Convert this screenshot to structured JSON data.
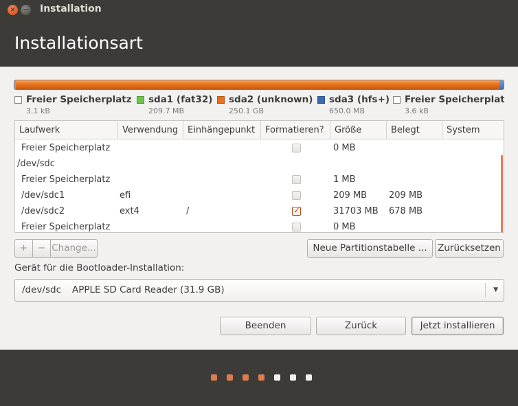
{
  "window": {
    "title": "Installation"
  },
  "header": {
    "title": "Installationsart"
  },
  "legend": [
    {
      "name": "Freier Speicherplatz",
      "size": "3.1 kB",
      "color": "#ffffff"
    },
    {
      "name": "sda1 (fat32)",
      "size": "209.7 MB",
      "color": "#6cc644"
    },
    {
      "name": "sda2 (unknown)",
      "size": "250.1 GB",
      "color": "#e9711f"
    },
    {
      "name": "sda3 (hfs+)",
      "size": "650.0 MB",
      "color": "#3a6bb0"
    },
    {
      "name": "Freier Speicherplatz",
      "size": "3.6 kB",
      "color": "#ffffff"
    }
  ],
  "table": {
    "columns": [
      "Laufwerk",
      "Verwendung",
      "Einhängepunkt",
      "Formatieren?",
      "Größe",
      "Belegt",
      "System"
    ],
    "rows": [
      {
        "device": "Freier Speicherplatz",
        "use": "",
        "mount": "",
        "format": false,
        "format_visible": true,
        "size": "0 MB",
        "used": "",
        "system": "",
        "indent": true
      },
      {
        "device": "/dev/sdc",
        "use": "",
        "mount": "",
        "format": false,
        "format_visible": false,
        "size": "",
        "used": "",
        "system": "",
        "indent": false
      },
      {
        "device": "Freier Speicherplatz",
        "use": "",
        "mount": "",
        "format": false,
        "format_visible": true,
        "size": "1 MB",
        "used": "",
        "system": "",
        "indent": true
      },
      {
        "device": "/dev/sdc1",
        "use": "efi",
        "mount": "",
        "format": false,
        "format_visible": true,
        "size": "209 MB",
        "used": "209 MB",
        "system": "",
        "indent": true
      },
      {
        "device": "/dev/sdc2",
        "use": "ext4",
        "mount": "/",
        "format": true,
        "format_visible": true,
        "size": "31703 MB",
        "used": "678 MB",
        "system": "",
        "indent": true
      },
      {
        "device": "Freier Speicherplatz",
        "use": "",
        "mount": "",
        "format": false,
        "format_visible": true,
        "size": "0 MB",
        "used": "",
        "system": "",
        "indent": true
      }
    ]
  },
  "table_actions": {
    "add": "+",
    "remove": "−",
    "change": "Change...",
    "new_table": "Neue Partitionstabelle ...",
    "reset": "Zurücksetzen"
  },
  "bootloader": {
    "label": "Gerät für die Bootloader-Installation:",
    "device": "/dev/sdc",
    "description": "APPLE SD Card Reader (31.9 GB)"
  },
  "buttons": {
    "quit": "Beenden",
    "back": "Zurück",
    "install": "Jetzt installieren"
  },
  "progress": {
    "total_steps": 7,
    "completed_steps": 4
  }
}
